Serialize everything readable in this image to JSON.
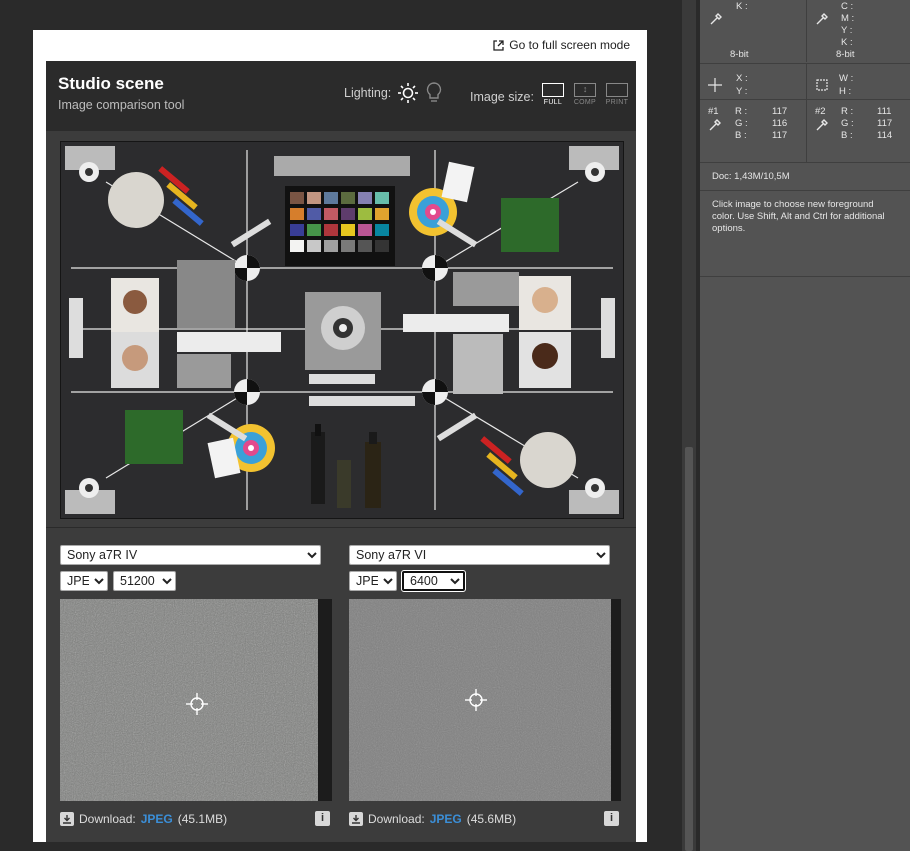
{
  "page": {
    "fullscreen_link": "Go to full screen mode"
  },
  "tool": {
    "title": "Studio scene",
    "subtitle": "Image comparison tool",
    "lighting_label": "Lighting:",
    "image_size_label": "Image size:",
    "size_options": [
      "FULL",
      "COMP",
      "PRINT"
    ],
    "active_size": "FULL"
  },
  "left": {
    "camera": "Sony a7R IV",
    "format": "JPEG",
    "iso": "51200",
    "download_label": "Download:",
    "download_link": "JPEG",
    "download_size": "(45.1MB)"
  },
  "right": {
    "camera": "Sony a7R VI",
    "format": "JPEG",
    "iso": "6400",
    "download_label": "Download:",
    "download_link": "JPEG",
    "download_size": "(45.6MB)"
  },
  "info_panel": {
    "cmyk_left_label": "K :",
    "cmyk_right_labels": [
      "C :",
      "M :",
      "Y :",
      "K :"
    ],
    "bit_left": "8-bit",
    "bit_right": "8-bit",
    "xy_labels": [
      "X :",
      "Y :"
    ],
    "wh_labels": [
      "W :",
      "H :"
    ],
    "sample1": {
      "id": "#1",
      "labels": [
        "R :",
        "G :",
        "B :"
      ],
      "values": [
        "117",
        "116",
        "117"
      ]
    },
    "sample2": {
      "id": "#2",
      "labels": [
        "R :",
        "G :",
        "B :"
      ],
      "values": [
        "111",
        "117",
        "114"
      ]
    },
    "doc": "Doc: 1,43M/10,5M",
    "hint": "Click image to choose new foreground color.  Use Shift, Alt and Ctrl for additional options."
  },
  "colors": {
    "link": "#3b8fd8",
    "panel_bg": "#535353",
    "tool_bg": "#3c3c3c"
  }
}
